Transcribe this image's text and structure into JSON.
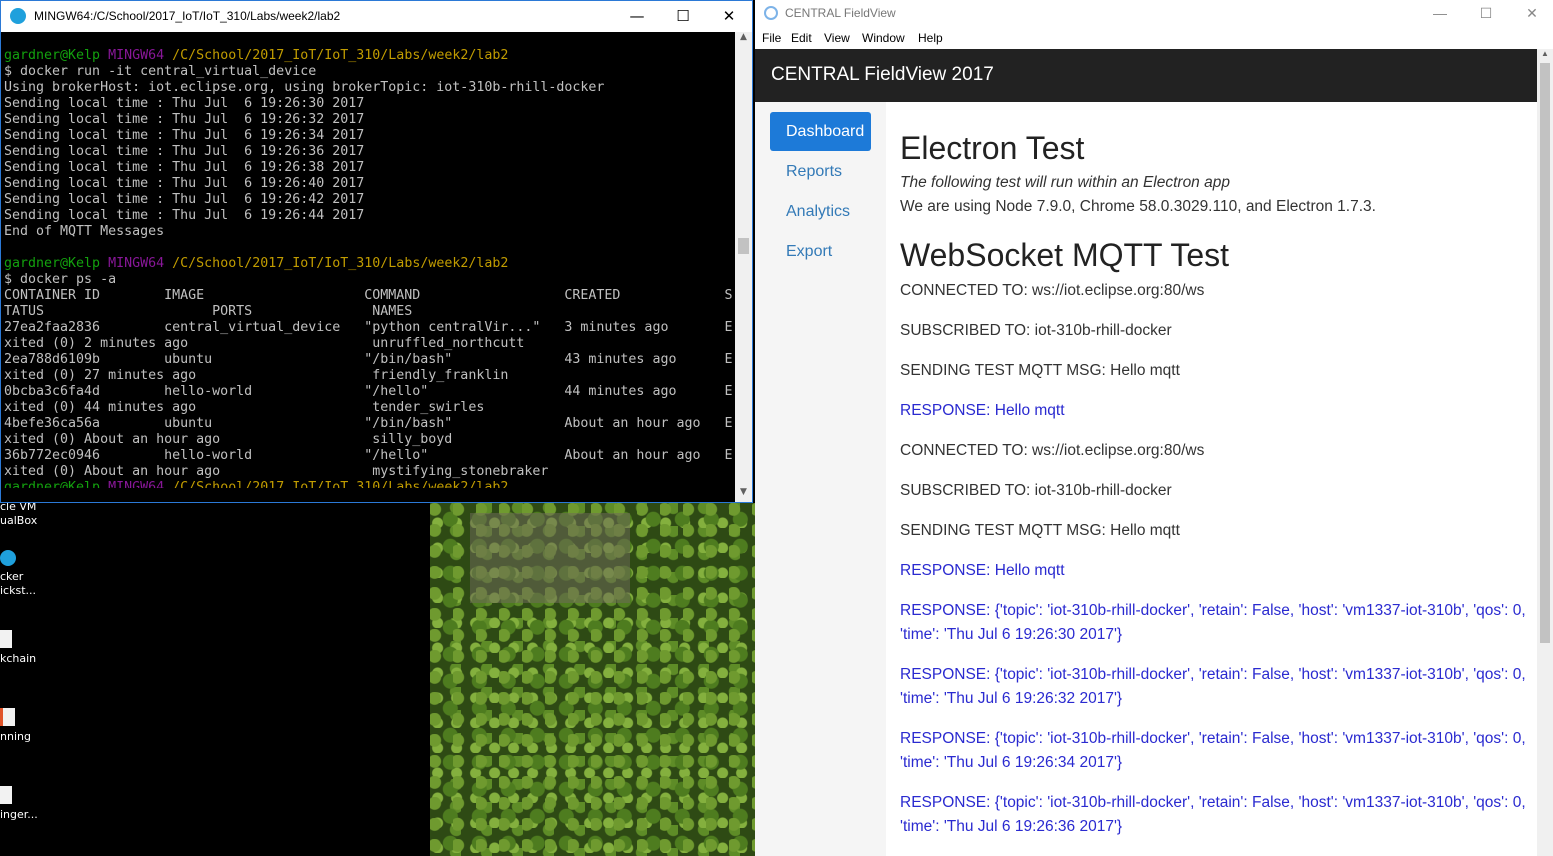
{
  "terminal": {
    "title": "MINGW64:/C/School/2017_IoT/IoT_310/Labs/week2/lab2",
    "controls": {
      "minimize": "—",
      "maximize": "☐",
      "close": "✕"
    },
    "prompt1": {
      "user": "gardner@Kelp",
      "shell": "MINGW64",
      "path": "/C/School/2017_IoT/IoT_310/Labs/week2/lab2"
    },
    "block1": [
      "$ docker run -it central_virtual_device",
      "Using brokerHost: iot.eclipse.org, using brokerTopic: iot-310b-rhill-docker",
      "Sending local time : Thu Jul  6 19:26:30 2017",
      "Sending local time : Thu Jul  6 19:26:32 2017",
      "Sending local time : Thu Jul  6 19:26:34 2017",
      "Sending local time : Thu Jul  6 19:26:36 2017",
      "Sending local time : Thu Jul  6 19:26:38 2017",
      "Sending local time : Thu Jul  6 19:26:40 2017",
      "Sending local time : Thu Jul  6 19:26:42 2017",
      "Sending local time : Thu Jul  6 19:26:44 2017",
      "End of MQTT Messages",
      ""
    ],
    "prompt2": {
      "user": "gardner@Kelp",
      "shell": "MINGW64",
      "path": "/C/School/2017_IoT/IoT_310/Labs/week2/lab2"
    },
    "block2": [
      "$ docker ps -a",
      "CONTAINER ID        IMAGE                    COMMAND                  CREATED             S",
      "TATUS                     PORTS               NAMES",
      "27ea2faa2836        central_virtual_device   \"python centralVir...\"   3 minutes ago       E",
      "xited (0) 2 minutes ago                       unruffled_northcutt",
      "2ea788d6109b        ubuntu                   \"/bin/bash\"              43 minutes ago      E",
      "xited (0) 27 minutes ago                      friendly_franklin",
      "0bcba3c6fa4d        hello-world              \"/hello\"                 44 minutes ago      E",
      "xited (0) 44 minutes ago                      tender_swirles",
      "4befe36ca56a        ubuntu                   \"/bin/bash\"              About an hour ago   E",
      "xited (0) About an hour ago                   silly_boyd",
      "36b772ec0946        hello-world              \"/hello\"                 About an hour ago   E",
      "xited (0) About an hour ago                   mystifying_stonebraker"
    ],
    "prompt3": {
      "user": "gardner@Kelp",
      "shell": "MINGW64",
      "path": "/C/School/2017_IoT/IoT_310/Labs/week2/lab2"
    }
  },
  "desktop": {
    "icons": [
      {
        "label": "cle VM\nualBox"
      },
      {
        "label": "cker\nickst..."
      },
      {
        "label": "kchain"
      },
      {
        "label": "nning"
      },
      {
        "label": "inger..."
      }
    ]
  },
  "electron": {
    "title": "CENTRAL FieldView",
    "controls": {
      "minimize": "—",
      "maximize": "☐",
      "close": "✕"
    },
    "menu": [
      "File",
      "Edit",
      "View",
      "Window",
      "Help"
    ],
    "brand": "CENTRAL FieldView 2017",
    "nav": [
      {
        "label": "Dashboard",
        "active": true
      },
      {
        "label": "Reports",
        "active": false
      },
      {
        "label": "Analytics",
        "active": false
      },
      {
        "label": "Export",
        "active": false
      }
    ],
    "main": {
      "heading1": "Electron Test",
      "subtitle": "The following test will run within an Electron app",
      "versions": "We are using Node 7.9.0, Chrome 58.0.3029.110, and Electron 1.7.3.",
      "heading2": "WebSocket MQTT Test",
      "log": [
        {
          "text": "CONNECTED TO: ws://iot.eclipse.org:80/ws",
          "type": "status"
        },
        {
          "text": "SUBSCRIBED TO: iot-310b-rhill-docker",
          "type": "status"
        },
        {
          "text": "SENDING TEST MQTT MSG: Hello mqtt",
          "type": "status"
        },
        {
          "text": "RESPONSE: Hello mqtt",
          "type": "response"
        },
        {
          "text": "CONNECTED TO: ws://iot.eclipse.org:80/ws",
          "type": "status"
        },
        {
          "text": "SUBSCRIBED TO: iot-310b-rhill-docker",
          "type": "status"
        },
        {
          "text": "SENDING TEST MQTT MSG: Hello mqtt",
          "type": "status"
        },
        {
          "text": "RESPONSE: Hello mqtt",
          "type": "response"
        },
        {
          "text": "RESPONSE: {'topic': 'iot-310b-rhill-docker', 'retain': False, 'host': 'vm1337-iot-310b', 'qos': 0, 'time': 'Thu Jul 6 19:26:30 2017'}",
          "type": "response"
        },
        {
          "text": "RESPONSE: {'topic': 'iot-310b-rhill-docker', 'retain': False, 'host': 'vm1337-iot-310b', 'qos': 0, 'time': 'Thu Jul 6 19:26:32 2017'}",
          "type": "response"
        },
        {
          "text": "RESPONSE: {'topic': 'iot-310b-rhill-docker', 'retain': False, 'host': 'vm1337-iot-310b', 'qos': 0, 'time': 'Thu Jul 6 19:26:34 2017'}",
          "type": "response"
        },
        {
          "text": "RESPONSE: {'topic': 'iot-310b-rhill-docker', 'retain': False, 'host': 'vm1337-iot-310b', 'qos': 0, 'time': 'Thu Jul 6 19:26:36 2017'}",
          "type": "response"
        }
      ]
    }
  },
  "colors": {
    "terminal_user": "#13a10e",
    "terminal_shell": "#881798",
    "terminal_path": "#c19c00",
    "navbar_bg": "#222222",
    "active_nav": "#1d7ad8",
    "response_text": "#2a2ad0"
  }
}
